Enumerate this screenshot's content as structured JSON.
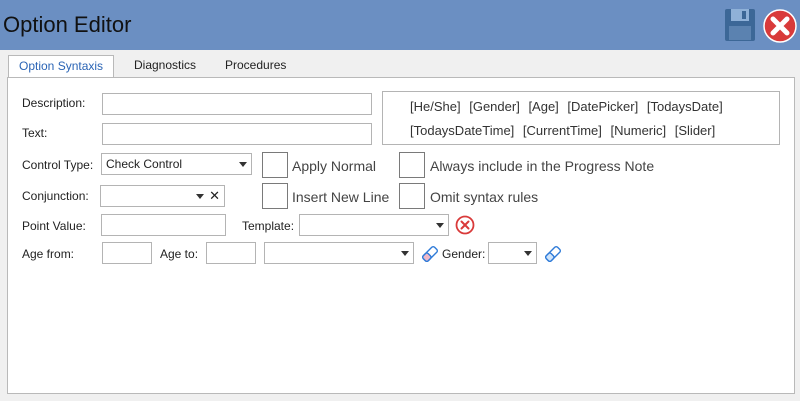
{
  "window": {
    "title": "Option Editor"
  },
  "icons": {
    "save": "floppy-disk-icon",
    "close": "close-x-icon",
    "clear": "clear-circle-x-icon",
    "eraser": "eraser-icon"
  },
  "colors": {
    "titlebar": "#6b8fc2",
    "accent": "#2a64b5",
    "close_red": "#d93a3a"
  },
  "tabs": [
    {
      "label": "Option Syntaxis",
      "active": true
    },
    {
      "label": "Diagnostics",
      "active": false
    },
    {
      "label": "Procedures",
      "active": false
    }
  ],
  "form": {
    "description_label": "Description:",
    "description_value": "",
    "text_label": "Text:",
    "text_value": "",
    "control_type_label": "Control Type:",
    "control_type_value": "Check Control",
    "conjunction_label": "Conjunction:",
    "conjunction_value": "",
    "conjunction_clear": "✕",
    "point_value_label": "Point Value:",
    "point_value_value": "",
    "template_label": "Template:",
    "template_value": "",
    "age_from_label": "Age from:",
    "age_from_value": "",
    "age_to_label": "Age to:",
    "age_to_value": "",
    "age_unit_value": "",
    "gender_label": "Gender:",
    "gender_value": ""
  },
  "checkboxes": {
    "apply_normal": "Apply Normal",
    "insert_new_line": "Insert New Line",
    "always_include": "Always include in the Progress Note",
    "omit_syntax": "Omit syntax rules"
  },
  "tokens": {
    "line1": [
      "[He/She]",
      "[Gender]",
      "[Age]",
      "[DatePicker]",
      "[TodaysDate]"
    ],
    "line2": [
      "[TodaysDateTime]",
      "[CurrentTime]",
      "[Numeric]",
      "[Slider]"
    ]
  }
}
